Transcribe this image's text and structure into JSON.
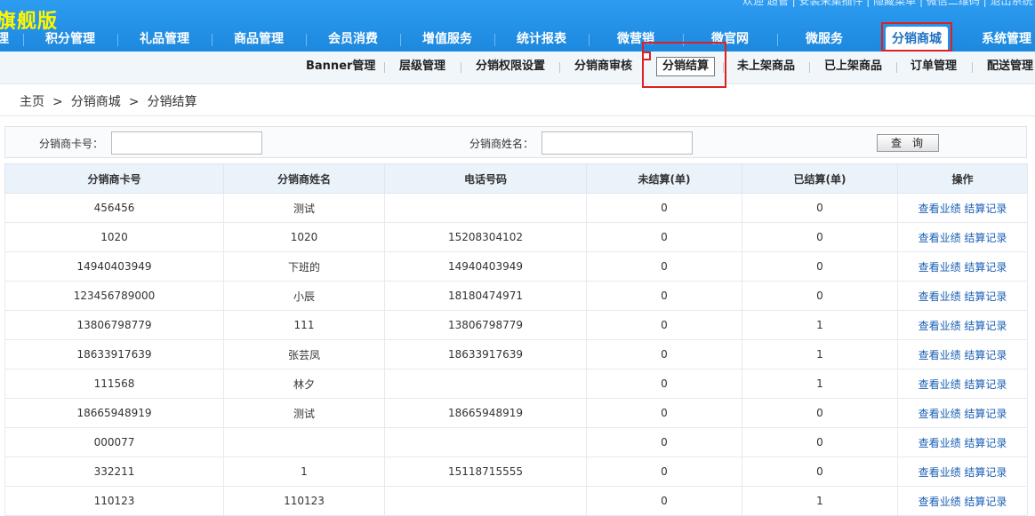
{
  "header": {
    "brand": "旗舰版",
    "top_links": "欢迎 超管 | 安装采集插件 | 隐藏菜单 | 微信二维码 | 退出系统"
  },
  "main_nav": {
    "items": [
      {
        "label": "理"
      },
      {
        "label": "积分管理"
      },
      {
        "label": "礼品管理"
      },
      {
        "label": "商品管理"
      },
      {
        "label": "会员消费"
      },
      {
        "label": "增值服务"
      },
      {
        "label": "统计报表"
      },
      {
        "label": "微营销"
      },
      {
        "label": "微官网"
      },
      {
        "label": "微服务"
      },
      {
        "label": "分销商城"
      },
      {
        "label": "系统管理"
      }
    ],
    "active": "分销商城"
  },
  "sub_nav": {
    "items": [
      {
        "label": "Banner管理"
      },
      {
        "label": "层级管理"
      },
      {
        "label": "分销权限设置"
      },
      {
        "label": "分销商审核"
      },
      {
        "label": "分销结算"
      },
      {
        "label": "未上架商品"
      },
      {
        "label": "已上架商品"
      },
      {
        "label": "订单管理"
      },
      {
        "label": "配送管理"
      }
    ],
    "active": "分销结算"
  },
  "breadcrumb": {
    "home": "主页",
    "sep": ">",
    "section": "分销商城",
    "current": "分销结算"
  },
  "search": {
    "card_label": "分销商卡号：",
    "card_value": "",
    "name_label": "分销商姓名：",
    "name_value": "",
    "button_label": "查询"
  },
  "table": {
    "columns": [
      "分销商卡号",
      "分销商姓名",
      "电话号码",
      "未结算(单)",
      "已结算(单)",
      "操作"
    ],
    "op_view": "查看业绩",
    "op_records": "结算记录",
    "rows": [
      {
        "card": "456456",
        "name": "测试",
        "phone": "",
        "unsettled": "0",
        "settled": "0"
      },
      {
        "card": "1020",
        "name": "1020",
        "phone": "15208304102",
        "unsettled": "0",
        "settled": "0"
      },
      {
        "card": "14940403949",
        "name": "下班的",
        "phone": "14940403949",
        "unsettled": "0",
        "settled": "0"
      },
      {
        "card": "123456789000",
        "name": "小辰",
        "phone": "18180474971",
        "unsettled": "0",
        "settled": "0"
      },
      {
        "card": "13806798779",
        "name": "111",
        "phone": "13806798779",
        "unsettled": "0",
        "settled": "1"
      },
      {
        "card": "18633917639",
        "name": "张芸凤",
        "phone": "18633917639",
        "unsettled": "0",
        "settled": "1"
      },
      {
        "card": "111568",
        "name": "林夕",
        "phone": "",
        "unsettled": "0",
        "settled": "1"
      },
      {
        "card": "18665948919",
        "name": "测试",
        "phone": "18665948919",
        "unsettled": "0",
        "settled": "0"
      },
      {
        "card": "000077",
        "name": "",
        "phone": "",
        "unsettled": "0",
        "settled": "0"
      },
      {
        "card": "332211",
        "name": "1",
        "phone": "15118715555",
        "unsettled": "0",
        "settled": "0"
      },
      {
        "card": "110123",
        "name": "110123",
        "phone": "",
        "unsettled": "0",
        "settled": "1"
      }
    ]
  },
  "colors": {
    "header_blue": "#1c88de",
    "brand_yellow": "#fff600",
    "highlight_red": "#e02020",
    "link_blue": "#1a5fb4"
  }
}
